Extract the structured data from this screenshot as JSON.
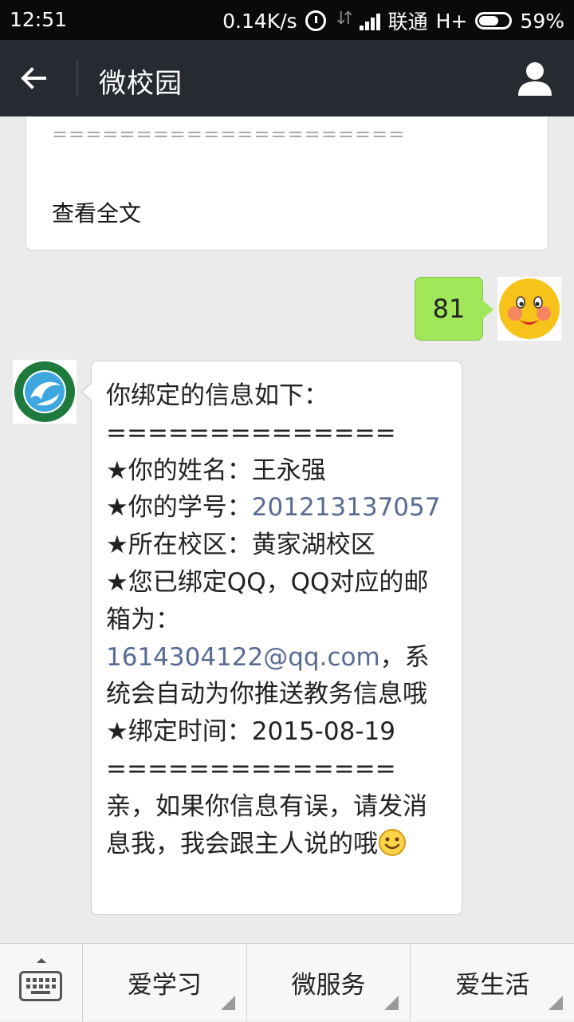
{
  "status_bar": {
    "time": "12:51",
    "net_speed": "0.14K/s",
    "carrier": "联通",
    "network": "H+",
    "battery": "59%",
    "battery_level": 0.59
  },
  "header": {
    "title": "微校园"
  },
  "article": {
    "separator": "=====================",
    "read_more": "查看全文"
  },
  "sent_message": {
    "text": "81"
  },
  "bot_message": {
    "lines": [
      "你绑定的信息如下：",
      "==============",
      "★你的姓名：王永强",
      "★你的学号：",
      "201213137057",
      "★所在校区：黄家湖校区",
      "★您已绑定QQ，QQ对应的邮",
      "箱为：",
      "1614304122@qq.com",
      "，系",
      "统会自动为你推送教务信息哦",
      "★绑定时间：2015-08-19",
      "==============",
      "亲，如果你信息有误，请发消",
      "息我，我会跟主人说的哦"
    ]
  },
  "bottom_menu": {
    "items": [
      "爱学习",
      "微服务",
      "爱生活"
    ]
  },
  "colors": {
    "header_bg": "#262b31",
    "sent_bubble": "#a0e75a",
    "link": "#576b95",
    "background": "#ebebeb"
  },
  "icons": {
    "back": "arrow-left-icon",
    "profile": "person-icon",
    "keyboard": "keyboard-icon",
    "smile": "smile-emoji-icon"
  }
}
